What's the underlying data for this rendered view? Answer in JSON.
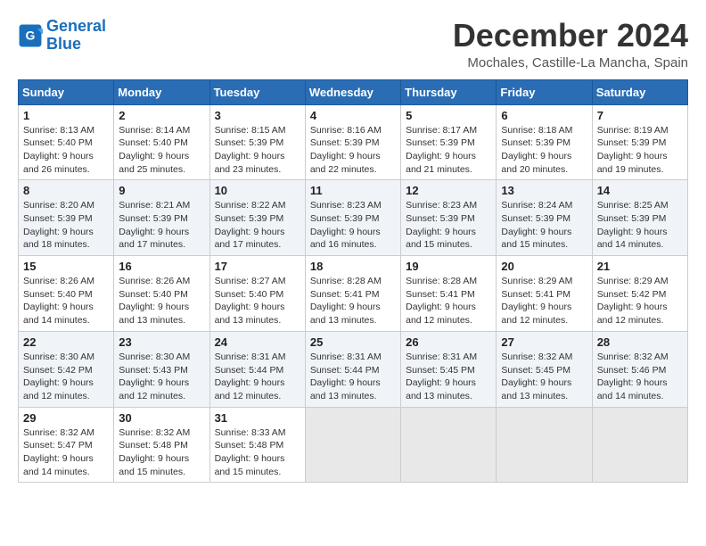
{
  "logo": {
    "line1": "General",
    "line2": "Blue"
  },
  "title": "December 2024",
  "location": "Mochales, Castille-La Mancha, Spain",
  "headers": [
    "Sunday",
    "Monday",
    "Tuesday",
    "Wednesday",
    "Thursday",
    "Friday",
    "Saturday"
  ],
  "weeks": [
    [
      {
        "day": "1",
        "sunrise": "8:13 AM",
        "sunset": "5:40 PM",
        "daylight": "9 hours and 26 minutes."
      },
      {
        "day": "2",
        "sunrise": "8:14 AM",
        "sunset": "5:40 PM",
        "daylight": "9 hours and 25 minutes."
      },
      {
        "day": "3",
        "sunrise": "8:15 AM",
        "sunset": "5:39 PM",
        "daylight": "9 hours and 23 minutes."
      },
      {
        "day": "4",
        "sunrise": "8:16 AM",
        "sunset": "5:39 PM",
        "daylight": "9 hours and 22 minutes."
      },
      {
        "day": "5",
        "sunrise": "8:17 AM",
        "sunset": "5:39 PM",
        "daylight": "9 hours and 21 minutes."
      },
      {
        "day": "6",
        "sunrise": "8:18 AM",
        "sunset": "5:39 PM",
        "daylight": "9 hours and 20 minutes."
      },
      {
        "day": "7",
        "sunrise": "8:19 AM",
        "sunset": "5:39 PM",
        "daylight": "9 hours and 19 minutes."
      }
    ],
    [
      {
        "day": "8",
        "sunrise": "8:20 AM",
        "sunset": "5:39 PM",
        "daylight": "9 hours and 18 minutes."
      },
      {
        "day": "9",
        "sunrise": "8:21 AM",
        "sunset": "5:39 PM",
        "daylight": "9 hours and 17 minutes."
      },
      {
        "day": "10",
        "sunrise": "8:22 AM",
        "sunset": "5:39 PM",
        "daylight": "9 hours and 17 minutes."
      },
      {
        "day": "11",
        "sunrise": "8:23 AM",
        "sunset": "5:39 PM",
        "daylight": "9 hours and 16 minutes."
      },
      {
        "day": "12",
        "sunrise": "8:23 AM",
        "sunset": "5:39 PM",
        "daylight": "9 hours and 15 minutes."
      },
      {
        "day": "13",
        "sunrise": "8:24 AM",
        "sunset": "5:39 PM",
        "daylight": "9 hours and 15 minutes."
      },
      {
        "day": "14",
        "sunrise": "8:25 AM",
        "sunset": "5:39 PM",
        "daylight": "9 hours and 14 minutes."
      }
    ],
    [
      {
        "day": "15",
        "sunrise": "8:26 AM",
        "sunset": "5:40 PM",
        "daylight": "9 hours and 14 minutes."
      },
      {
        "day": "16",
        "sunrise": "8:26 AM",
        "sunset": "5:40 PM",
        "daylight": "9 hours and 13 minutes."
      },
      {
        "day": "17",
        "sunrise": "8:27 AM",
        "sunset": "5:40 PM",
        "daylight": "9 hours and 13 minutes."
      },
      {
        "day": "18",
        "sunrise": "8:28 AM",
        "sunset": "5:41 PM",
        "daylight": "9 hours and 13 minutes."
      },
      {
        "day": "19",
        "sunrise": "8:28 AM",
        "sunset": "5:41 PM",
        "daylight": "9 hours and 12 minutes."
      },
      {
        "day": "20",
        "sunrise": "8:29 AM",
        "sunset": "5:41 PM",
        "daylight": "9 hours and 12 minutes."
      },
      {
        "day": "21",
        "sunrise": "8:29 AM",
        "sunset": "5:42 PM",
        "daylight": "9 hours and 12 minutes."
      }
    ],
    [
      {
        "day": "22",
        "sunrise": "8:30 AM",
        "sunset": "5:42 PM",
        "daylight": "9 hours and 12 minutes."
      },
      {
        "day": "23",
        "sunrise": "8:30 AM",
        "sunset": "5:43 PM",
        "daylight": "9 hours and 12 minutes."
      },
      {
        "day": "24",
        "sunrise": "8:31 AM",
        "sunset": "5:44 PM",
        "daylight": "9 hours and 12 minutes."
      },
      {
        "day": "25",
        "sunrise": "8:31 AM",
        "sunset": "5:44 PM",
        "daylight": "9 hours and 13 minutes."
      },
      {
        "day": "26",
        "sunrise": "8:31 AM",
        "sunset": "5:45 PM",
        "daylight": "9 hours and 13 minutes."
      },
      {
        "day": "27",
        "sunrise": "8:32 AM",
        "sunset": "5:45 PM",
        "daylight": "9 hours and 13 minutes."
      },
      {
        "day": "28",
        "sunrise": "8:32 AM",
        "sunset": "5:46 PM",
        "daylight": "9 hours and 14 minutes."
      }
    ],
    [
      {
        "day": "29",
        "sunrise": "8:32 AM",
        "sunset": "5:47 PM",
        "daylight": "9 hours and 14 minutes."
      },
      {
        "day": "30",
        "sunrise": "8:32 AM",
        "sunset": "5:48 PM",
        "daylight": "9 hours and 15 minutes."
      },
      {
        "day": "31",
        "sunrise": "8:33 AM",
        "sunset": "5:48 PM",
        "daylight": "9 hours and 15 minutes."
      },
      null,
      null,
      null,
      null
    ]
  ]
}
